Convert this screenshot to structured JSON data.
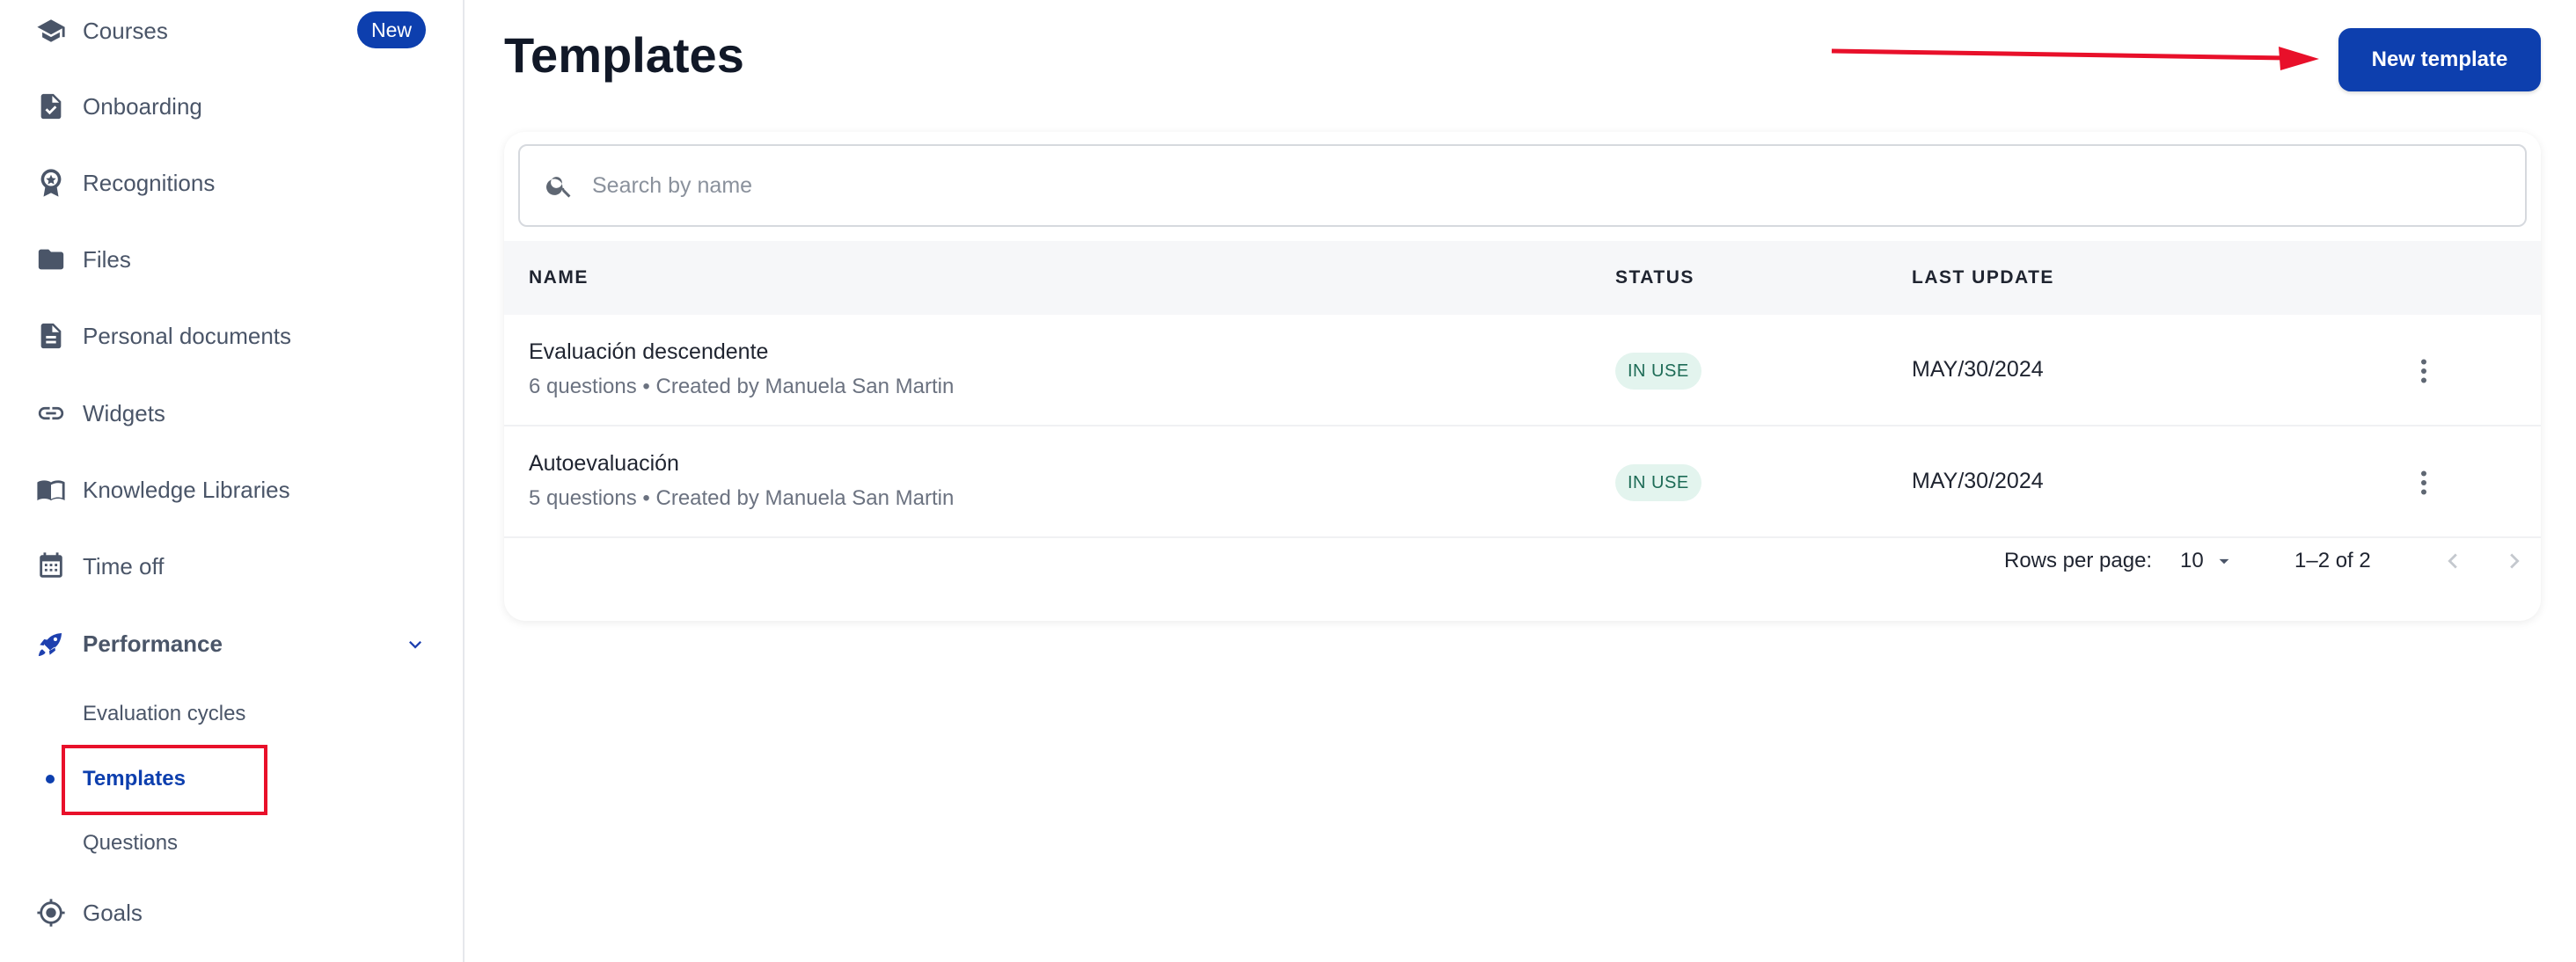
{
  "sidebar": {
    "items": [
      {
        "label": "Courses",
        "icon": "graduation-cap-icon"
      },
      {
        "label": "Onboarding",
        "icon": "document-check-icon"
      },
      {
        "label": "Recognitions",
        "icon": "award-ribbon-icon"
      },
      {
        "label": "Files",
        "icon": "folder-icon"
      },
      {
        "label": "Personal documents",
        "icon": "document-icon"
      },
      {
        "label": "Widgets",
        "icon": "link-icon"
      },
      {
        "label": "Knowledge Libraries",
        "icon": "book-open-icon"
      },
      {
        "label": "Time off",
        "icon": "calendar-icon"
      },
      {
        "label": "Performance",
        "icon": "rocket-icon"
      },
      {
        "label": "Goals",
        "icon": "target-icon"
      }
    ],
    "courses_badge": "New",
    "performance_subitems": [
      "Evaluation cycles",
      "Templates",
      "Questions"
    ],
    "active_subitem": "Templates"
  },
  "header": {
    "title": "Templates",
    "new_button_label": "New template"
  },
  "search": {
    "placeholder": "Search by name",
    "value": ""
  },
  "table": {
    "columns": [
      "NAME",
      "STATUS",
      "LAST UPDATE"
    ],
    "rows": [
      {
        "name": "Evaluación descendente",
        "meta": "6 questions • Created by Manuela San Martin",
        "status": "IN USE",
        "last_update": "MAY/30/2024"
      },
      {
        "name": "Autoevaluación",
        "meta": "5 questions • Created by Manuela San Martin",
        "status": "IN USE",
        "last_update": "MAY/30/2024"
      }
    ]
  },
  "pagination": {
    "rows_per_page_label": "Rows per page:",
    "rows_per_page_value": "10",
    "range": "1–2 of 2"
  },
  "colors": {
    "accent": "#0d3fae",
    "status_bg": "#e3f4ee",
    "status_text": "#1d6b56",
    "annotation_red": "#e8102a"
  }
}
